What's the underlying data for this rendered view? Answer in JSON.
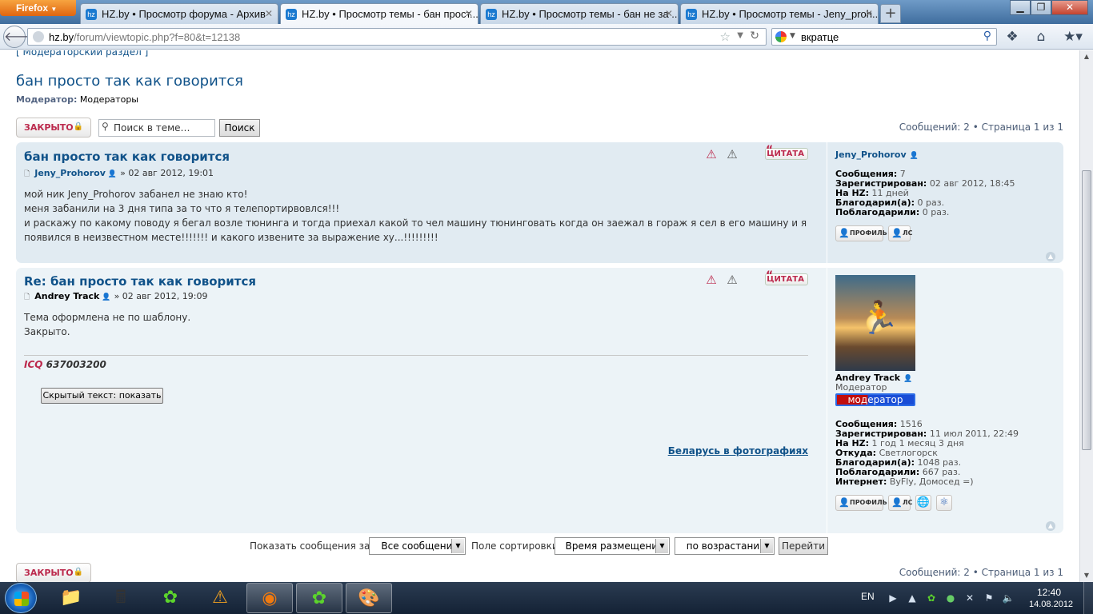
{
  "browser": {
    "app_button": "Firefox",
    "tabs": [
      {
        "title": "HZ.by • Просмотр форума - Архив"
      },
      {
        "title": "HZ.by • Просмотр темы - бан прост..."
      },
      {
        "title": "HZ.by • Просмотр темы - бан не за ..."
      },
      {
        "title": "HZ.by • Просмотр темы - Jeny_proh..."
      }
    ],
    "url_domain": "hz.by",
    "url_path": "/forum/viewtopic.php?f=80&t=12138",
    "search_query": "вкратце"
  },
  "forum": {
    "breadcrumb": "[ Модераторский раздел ]",
    "topic_title": "бан просто так как говорится",
    "moderator_label": "Модератор:",
    "moderator_value": "Модераторы",
    "locked_label": "ЗАКРЫТО",
    "search_placeholder": "Поиск в теме…",
    "search_button": "Поиск",
    "pagination": "Сообщений: 2 • Страница 1 из 1"
  },
  "posts": [
    {
      "title": "бан просто так как говорится",
      "author": "Jeny_Prohorov",
      "date": "» 02 авг 2012, 19:01",
      "lines": [
        "мой ник Jeny_Prohorov забанел не знаю кто!",
        "меня забанили на 3 дня типа за то что я телепортирвовлся!!!",
        "и раскажу по какому поводу я бегал возле тюнинга и тогда приехал какой то чел машину тюнинговать когда он заежал в гораж я сел в его машину и я",
        "появился в неизвестном месте!!!!!!! и какого извените за выражение ху...!!!!!!!!!"
      ],
      "quote_label": "ЦИТАТА",
      "profile": {
        "name": "Jeny_Prohorov",
        "messages_label": "Сообщения:",
        "messages": "7",
        "registered_label": "Зарегистрирован:",
        "registered": "02 авг 2012, 18:45",
        "onhz_label": "На HZ:",
        "onhz": "11 дней",
        "thanked_label": "Благодарил(а):",
        "thanked": "0 раз.",
        "got_thanks_label": "Поблагодарили:",
        "got_thanks": "0 раз.",
        "profile_btn": "ПРОФИЛЬ",
        "pm_btn": "ЛС"
      }
    },
    {
      "title": "Re: бан просто так как говорится",
      "author": "Andrey Track",
      "date": "» 02 авг 2012, 19:09",
      "lines": [
        "Тема оформлена не по шаблону.",
        "Закрыто."
      ],
      "quote_label": "ЦИТАТА",
      "signature_icq_label": "ICQ",
      "signature_icq": "637003200",
      "hidden_text_button": "Скрытый текст: показать",
      "signature_link": "Беларусь в фотографиях",
      "profile": {
        "name": "Andrey Track",
        "rank": "Модератор",
        "rank_badge": "модератор",
        "messages_label": "Сообщения:",
        "messages": "1516",
        "registered_label": "Зарегистрирован:",
        "registered": "11 июл 2011, 22:49",
        "onhz_label": "На HZ:",
        "onhz": "1 год 1 месяц 3 дня",
        "from_label": "Откуда:",
        "from": "Светлогорск",
        "thanked_label": "Благодарил(а):",
        "thanked": "1048 раз.",
        "got_thanks_label": "Поблагодарили:",
        "got_thanks": "667 раз.",
        "internet_label": "Интернет:",
        "internet": "ByFly, Домосед =)",
        "profile_btn": "ПРОФИЛЬ",
        "pm_btn": "ЛС"
      }
    }
  ],
  "sort": {
    "show_label": "Показать сообщения за:",
    "show_value": "Все сообщения",
    "sort_label": "Поле сортировки",
    "sort_value": "Время размещения",
    "order_value": "по возрастанию",
    "go_button": "Перейти"
  },
  "taskbar": {
    "language": "EN",
    "time": "12:40",
    "date": "14.08.2012"
  }
}
